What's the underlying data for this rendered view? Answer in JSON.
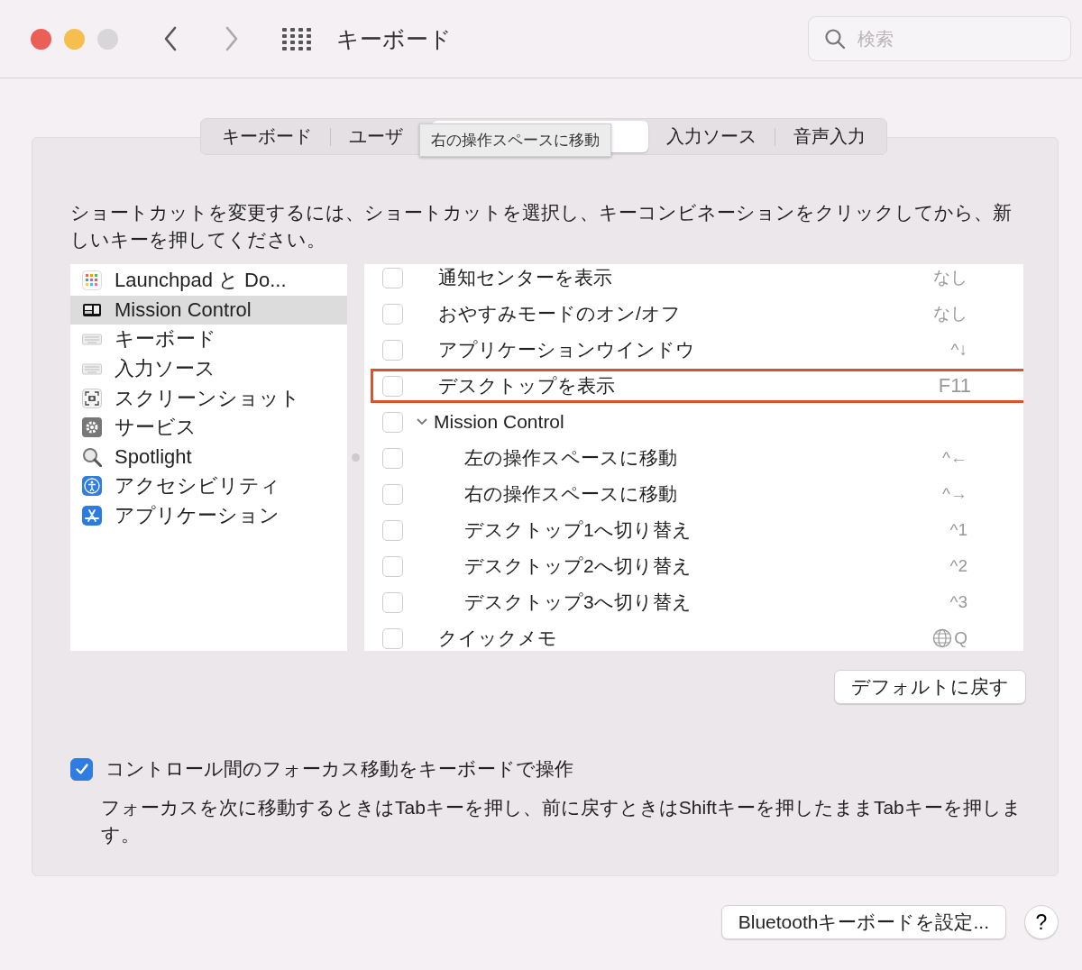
{
  "window": {
    "title": "キーボード",
    "search": {
      "placeholder": "検索"
    }
  },
  "tabs": [
    {
      "label": "キーボード",
      "selected": false
    },
    {
      "label": "ユーザ",
      "selected": false
    },
    {
      "selected": true
    },
    {
      "label": "入力ソース",
      "selected": false
    },
    {
      "label": "音声入力",
      "selected": false
    }
  ],
  "tooltip": "右の操作スペースに移動",
  "description": "ショートカットを変更するには、ショートカットを選択し、キーコンビネーションをクリックしてから、新しいキーを押してください。",
  "sidebar": {
    "items": [
      {
        "label": "Launchpad と Do...",
        "selected": false
      },
      {
        "label": "Mission Control",
        "selected": true
      },
      {
        "label": "キーボード",
        "selected": false
      },
      {
        "label": "入力ソース",
        "selected": false
      },
      {
        "label": "スクリーンショット",
        "selected": false
      },
      {
        "label": "サービス",
        "selected": false
      },
      {
        "label": "Spotlight",
        "selected": false
      },
      {
        "label": "アクセシビリティ",
        "selected": false
      },
      {
        "label": "アプリケーション",
        "selected": false
      }
    ]
  },
  "shortcuts": [
    {
      "label": "通知センターを表示",
      "shortcut": "なし",
      "checked": false
    },
    {
      "label": "おやすみモードのオン/オフ",
      "shortcut": "なし",
      "checked": false
    },
    {
      "label": "アプリケーションウインドウ",
      "shortcut": "^↓",
      "checked": false
    },
    {
      "label": "デスクトップを表示",
      "shortcut": "F11",
      "checked": false,
      "highlighted": true
    },
    {
      "label": "Mission Control",
      "checked": false,
      "expanded": true,
      "children": [
        {
          "label": "左の操作スペースに移動",
          "shortcut": "^←",
          "checked": false
        },
        {
          "label": "右の操作スペースに移動",
          "shortcut": "^→",
          "checked": false
        },
        {
          "label": "デスクトップ1へ切り替え",
          "shortcut": "^1",
          "checked": false
        },
        {
          "label": "デスクトップ2へ切り替え",
          "shortcut": "^2",
          "checked": false
        },
        {
          "label": "デスクトップ3へ切り替え",
          "shortcut": "^3",
          "checked": false
        }
      ]
    },
    {
      "label": "クイックメモ",
      "shortcut": "Q",
      "globe": true,
      "checked": false
    }
  ],
  "restore_button": "デフォルトに戻す",
  "focus_option": {
    "label": "コントロール間のフォーカス移動をキーボードで操作",
    "checked": true
  },
  "note": "フォーカスを次に移動するときはTabキーを押し、前に戻すときはShiftキーを押したままTabキーを押します。",
  "bluetooth_button": "Bluetoothキーボードを設定...",
  "help_button": "?"
}
